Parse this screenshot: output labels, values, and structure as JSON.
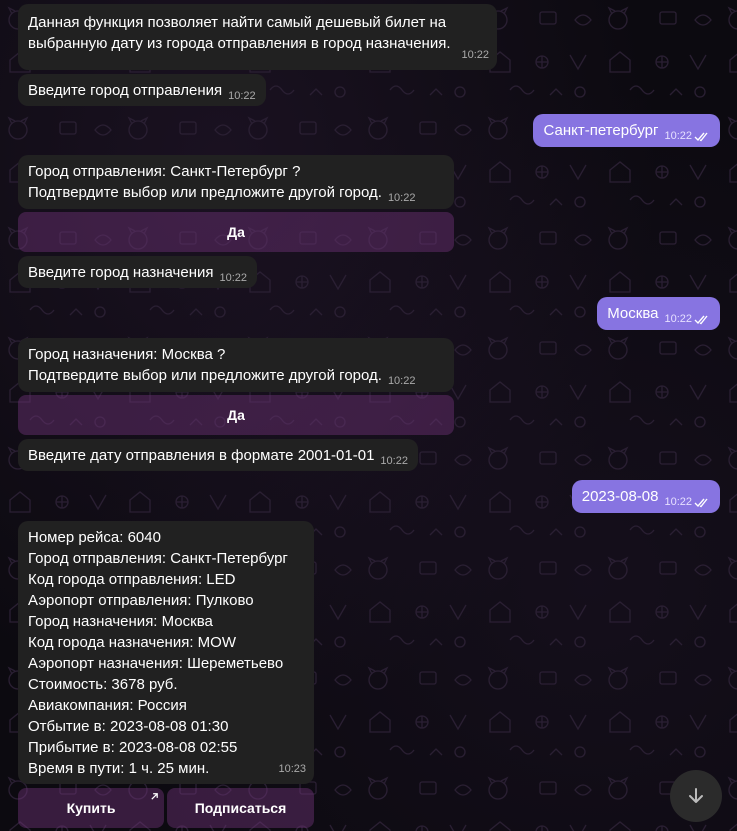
{
  "messages": {
    "intro": {
      "text": "Данная функция позволяет найти самый дешевый билет на выбранную дату из города отправления в город назначения.",
      "time": "10:22"
    },
    "ask_origin": {
      "text": "Введите город отправления",
      "time": "10:22"
    },
    "user_origin": {
      "text": "Санкт-петербург",
      "time": "10:22"
    },
    "confirm_origin": {
      "line1": "Город отправления: Санкт-Петербург ?",
      "line2": "Подтвердите выбор или предложите другой город.",
      "time": "10:22",
      "button": "Да"
    },
    "ask_dest": {
      "text": "Введите город назначения",
      "time": "10:22"
    },
    "user_dest": {
      "text": "Москва",
      "time": "10:22"
    },
    "confirm_dest": {
      "line1": "Город назначения: Москва ?",
      "line2": "Подтвердите выбор или предложите другой город.",
      "time": "10:22",
      "button": "Да"
    },
    "ask_date": {
      "text": "Введите дату отправления в формате 2001-01-01",
      "time": "10:22"
    },
    "user_date": {
      "text": "2023-08-08",
      "time": "10:22"
    },
    "result": {
      "lines": [
        "Номер рейса: 6040",
        "Город отправления: Санкт-Петербург",
        "Код города отправления: LED",
        "Аэропорт отправления: Пулково",
        "Город назначения: Москва",
        "Код города назначения: MOW",
        "Аэропорт назначения: Шереметьево",
        "Стоимость: 3678 руб.",
        "Авиакомпания: Россия",
        "Отбытие в: 2023-08-08 01:30",
        "Прибытие в: 2023-08-08 02:55",
        "Время в пути: 1 ч. 25 мин."
      ],
      "time": "10:23",
      "buy_button": "Купить",
      "subscribe_button": "Подписаться"
    }
  },
  "icons": {
    "read_receipt": "double-check-icon",
    "scroll_down": "arrow-down-icon",
    "external_link": "arrow-up-right-icon"
  },
  "colors": {
    "incoming_bubble": "#212121",
    "outgoing_bubble": "#8774e1",
    "inline_button": "#5a2a66",
    "background": "#0c0a10"
  }
}
